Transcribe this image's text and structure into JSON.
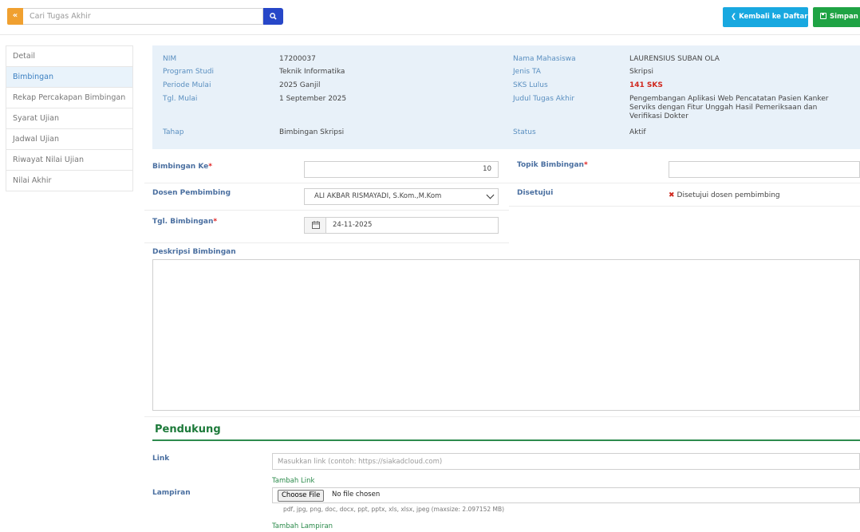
{
  "topbar": {
    "collapse_icon": "chevron-left-double-icon",
    "search_placeholder": "Cari Tugas Akhir",
    "back_label": "Kembali ke Daftar",
    "save_label": "Simpan"
  },
  "sidebar": {
    "items": [
      {
        "label": "Detail",
        "active": false
      },
      {
        "label": "Bimbingan",
        "active": true
      },
      {
        "label": "Rekap Percakapan Bimbingan",
        "active": false
      },
      {
        "label": "Syarat Ujian",
        "active": false
      },
      {
        "label": "Jadwal Ujian",
        "active": false
      },
      {
        "label": "Riwayat Nilai Ujian",
        "active": false
      },
      {
        "label": "Nilai Akhir",
        "active": false
      }
    ]
  },
  "info": {
    "nim_label": "NIM",
    "nim": "17200037",
    "prodi_label": "Program Studi",
    "prodi": "Teknik Informatika",
    "periode_label": "Periode Mulai",
    "periode": "2025 Ganjil",
    "tgl_mulai_label": "Tgl. Mulai",
    "tgl_mulai": "1 September 2025",
    "tahap_label": "Tahap",
    "tahap": "Bimbingan Skripsi",
    "nama_label": "Nama Mahasiswa",
    "nama": "LAURENSIUS SUBAN OLA",
    "jenis_label": "Jenis TA",
    "jenis": "Skripsi",
    "sks_label": "SKS Lulus",
    "sks": "141 SKS",
    "judul_label": "Judul Tugas Akhir",
    "judul": "Pengembangan Aplikasi Web Pencatatan Pasien Kanker Serviks dengan Fitur Unggah Hasil Pemeriksaan dan Verifikasi Dokter",
    "status_label": "Status",
    "status": "Aktif"
  },
  "form": {
    "bimbingan_ke_label": "Bimbingan Ke",
    "bimbingan_ke": "10",
    "topik_label": "Topik Bimbingan",
    "topik": "",
    "dosen_label": "Dosen Pembimbing",
    "dosen": "ALI AKBAR RISMAYADI, S.Kom.,M.Kom",
    "disetujui_label": "Disetujui",
    "disetujui_value": "Disetujui dosen pembimbing",
    "tgl_label": "Tgl. Bimbingan",
    "tgl": "24-11-2025",
    "deskripsi_label": "Deskripsi Bimbingan",
    "deskripsi": "",
    "required_mark": "*"
  },
  "pendukung": {
    "title": "Pendukung",
    "link_label": "Link",
    "link_placeholder": "Masukkan link (contoh: https://siakadcloud.com)",
    "add_link": "Tambah Link",
    "lampiran_label": "Lampiran",
    "choose_file": "Choose File",
    "no_file": "No file chosen",
    "file_hint": "pdf, jpg, png, doc, docx, ppt, pptx, xls, xlsx, jpeg (maxsize: 2.097152 MB)",
    "add_lampiran": "Tambah Lampiran"
  },
  "colors": {
    "accent": "#2747c8",
    "back_button": "#18a8e0",
    "save_button": "#1fa344",
    "collapse_button": "#f0a030",
    "info_panel": "#e8f1f9",
    "section_green": "#1d7a3a"
  }
}
